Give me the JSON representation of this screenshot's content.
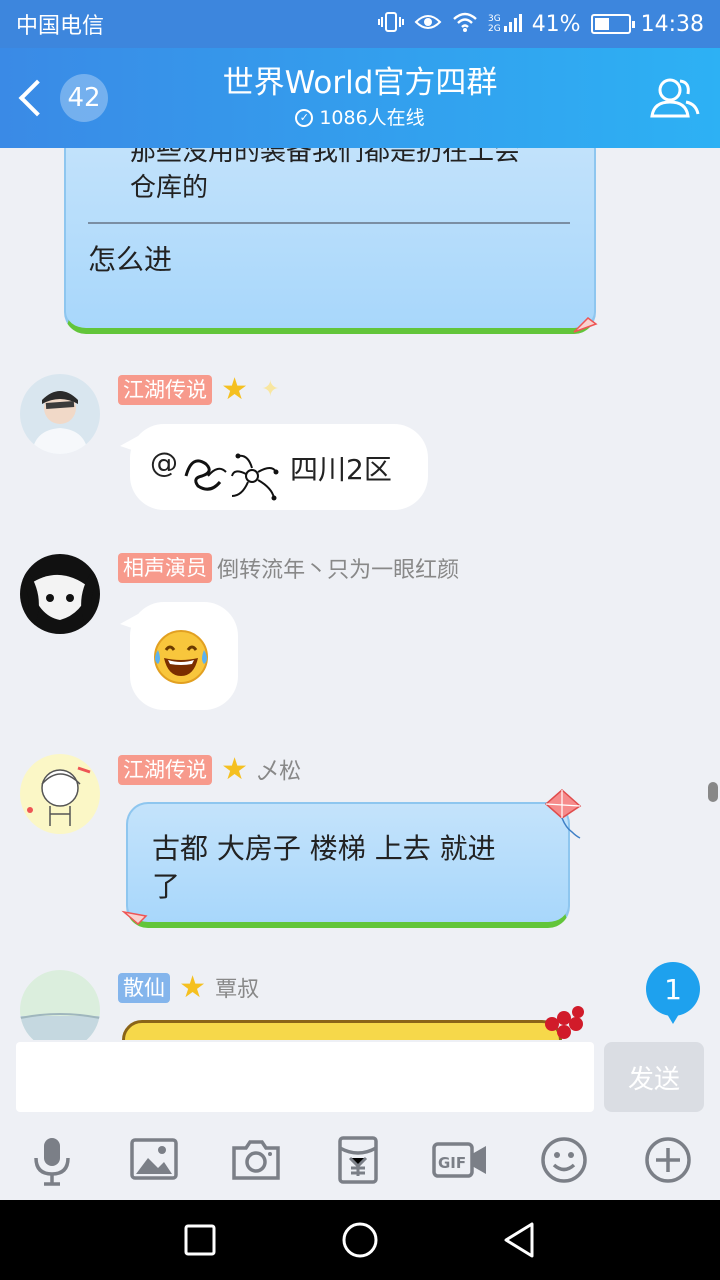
{
  "status_bar": {
    "carrier": "中国电信",
    "network": "3G 2G",
    "battery": "41%",
    "battery_level": 0.41,
    "time": "14:38"
  },
  "header": {
    "unread_count": "42",
    "title": "世界World官方四群",
    "online": "1086人在线"
  },
  "messages": [
    {
      "type": "quoted",
      "quote_text": "那些没用的装备我们都是扔在工会\n仓库的",
      "reply_text": "怎么进"
    },
    {
      "badge": "江湖传说",
      "nickname": "",
      "text_prefix": "@",
      "text_suffix": "四川2区"
    },
    {
      "badge": "相声演员",
      "nickname": "倒转流年丶只为一眼红颜",
      "emoji": "😂"
    },
    {
      "badge": "江湖传说",
      "nickname": "乄松",
      "text": "古都 大房子  楼梯 上去 就进\n了"
    },
    {
      "badge": "散仙",
      "nickname": "覃叔"
    }
  ],
  "new_messages": "1",
  "input": {
    "placeholder": "",
    "send_label": "发送"
  },
  "toolbar_icons": [
    "mic-icon",
    "image-icon",
    "camera-icon",
    "red-packet-icon",
    "gif-icon",
    "emoji-icon",
    "plus-icon"
  ]
}
